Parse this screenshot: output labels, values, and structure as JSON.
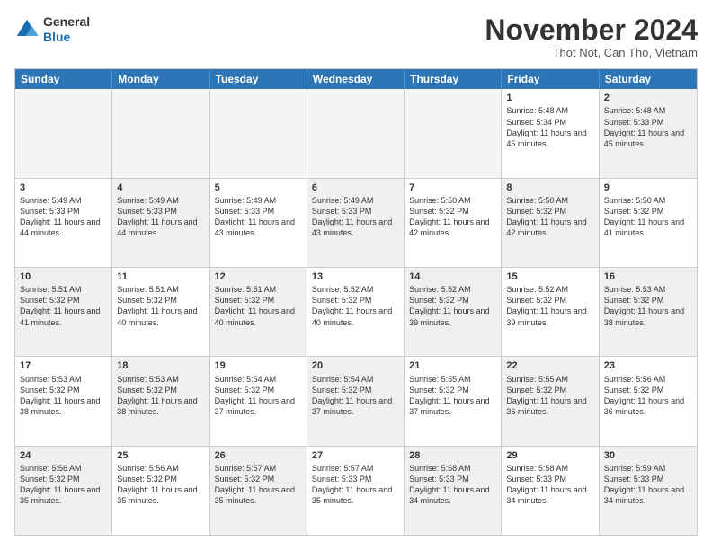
{
  "logo": {
    "general": "General",
    "blue": "Blue"
  },
  "title": "November 2024",
  "subtitle": "Thot Not, Can Tho, Vietnam",
  "days_header": [
    "Sunday",
    "Monday",
    "Tuesday",
    "Wednesday",
    "Thursday",
    "Friday",
    "Saturday"
  ],
  "weeks": [
    [
      {
        "day": "",
        "info": "",
        "empty": true
      },
      {
        "day": "",
        "info": "",
        "empty": true
      },
      {
        "day": "",
        "info": "",
        "empty": true
      },
      {
        "day": "",
        "info": "",
        "empty": true
      },
      {
        "day": "",
        "info": "",
        "empty": true
      },
      {
        "day": "1",
        "info": "Sunrise: 5:48 AM\nSunset: 5:34 PM\nDaylight: 11 hours and 45 minutes."
      },
      {
        "day": "2",
        "info": "Sunrise: 5:48 AM\nSunset: 5:33 PM\nDaylight: 11 hours and 45 minutes.",
        "shaded": true
      }
    ],
    [
      {
        "day": "3",
        "info": "Sunrise: 5:49 AM\nSunset: 5:33 PM\nDaylight: 11 hours and 44 minutes."
      },
      {
        "day": "4",
        "info": "Sunrise: 5:49 AM\nSunset: 5:33 PM\nDaylight: 11 hours and 44 minutes.",
        "shaded": true
      },
      {
        "day": "5",
        "info": "Sunrise: 5:49 AM\nSunset: 5:33 PM\nDaylight: 11 hours and 43 minutes."
      },
      {
        "day": "6",
        "info": "Sunrise: 5:49 AM\nSunset: 5:33 PM\nDaylight: 11 hours and 43 minutes.",
        "shaded": true
      },
      {
        "day": "7",
        "info": "Sunrise: 5:50 AM\nSunset: 5:32 PM\nDaylight: 11 hours and 42 minutes."
      },
      {
        "day": "8",
        "info": "Sunrise: 5:50 AM\nSunset: 5:32 PM\nDaylight: 11 hours and 42 minutes.",
        "shaded": true
      },
      {
        "day": "9",
        "info": "Sunrise: 5:50 AM\nSunset: 5:32 PM\nDaylight: 11 hours and 41 minutes."
      }
    ],
    [
      {
        "day": "10",
        "info": "Sunrise: 5:51 AM\nSunset: 5:32 PM\nDaylight: 11 hours and 41 minutes.",
        "shaded": true
      },
      {
        "day": "11",
        "info": "Sunrise: 5:51 AM\nSunset: 5:32 PM\nDaylight: 11 hours and 40 minutes."
      },
      {
        "day": "12",
        "info": "Sunrise: 5:51 AM\nSunset: 5:32 PM\nDaylight: 11 hours and 40 minutes.",
        "shaded": true
      },
      {
        "day": "13",
        "info": "Sunrise: 5:52 AM\nSunset: 5:32 PM\nDaylight: 11 hours and 40 minutes."
      },
      {
        "day": "14",
        "info": "Sunrise: 5:52 AM\nSunset: 5:32 PM\nDaylight: 11 hours and 39 minutes.",
        "shaded": true
      },
      {
        "day": "15",
        "info": "Sunrise: 5:52 AM\nSunset: 5:32 PM\nDaylight: 11 hours and 39 minutes."
      },
      {
        "day": "16",
        "info": "Sunrise: 5:53 AM\nSunset: 5:32 PM\nDaylight: 11 hours and 38 minutes.",
        "shaded": true
      }
    ],
    [
      {
        "day": "17",
        "info": "Sunrise: 5:53 AM\nSunset: 5:32 PM\nDaylight: 11 hours and 38 minutes."
      },
      {
        "day": "18",
        "info": "Sunrise: 5:53 AM\nSunset: 5:32 PM\nDaylight: 11 hours and 38 minutes.",
        "shaded": true
      },
      {
        "day": "19",
        "info": "Sunrise: 5:54 AM\nSunset: 5:32 PM\nDaylight: 11 hours and 37 minutes."
      },
      {
        "day": "20",
        "info": "Sunrise: 5:54 AM\nSunset: 5:32 PM\nDaylight: 11 hours and 37 minutes.",
        "shaded": true
      },
      {
        "day": "21",
        "info": "Sunrise: 5:55 AM\nSunset: 5:32 PM\nDaylight: 11 hours and 37 minutes."
      },
      {
        "day": "22",
        "info": "Sunrise: 5:55 AM\nSunset: 5:32 PM\nDaylight: 11 hours and 36 minutes.",
        "shaded": true
      },
      {
        "day": "23",
        "info": "Sunrise: 5:56 AM\nSunset: 5:32 PM\nDaylight: 11 hours and 36 minutes."
      }
    ],
    [
      {
        "day": "24",
        "info": "Sunrise: 5:56 AM\nSunset: 5:32 PM\nDaylight: 11 hours and 35 minutes.",
        "shaded": true
      },
      {
        "day": "25",
        "info": "Sunrise: 5:56 AM\nSunset: 5:32 PM\nDaylight: 11 hours and 35 minutes."
      },
      {
        "day": "26",
        "info": "Sunrise: 5:57 AM\nSunset: 5:32 PM\nDaylight: 11 hours and 35 minutes.",
        "shaded": true
      },
      {
        "day": "27",
        "info": "Sunrise: 5:57 AM\nSunset: 5:33 PM\nDaylight: 11 hours and 35 minutes."
      },
      {
        "day": "28",
        "info": "Sunrise: 5:58 AM\nSunset: 5:33 PM\nDaylight: 11 hours and 34 minutes.",
        "shaded": true
      },
      {
        "day": "29",
        "info": "Sunrise: 5:58 AM\nSunset: 5:33 PM\nDaylight: 11 hours and 34 minutes."
      },
      {
        "day": "30",
        "info": "Sunrise: 5:59 AM\nSunset: 5:33 PM\nDaylight: 11 hours and 34 minutes.",
        "shaded": true
      }
    ]
  ]
}
